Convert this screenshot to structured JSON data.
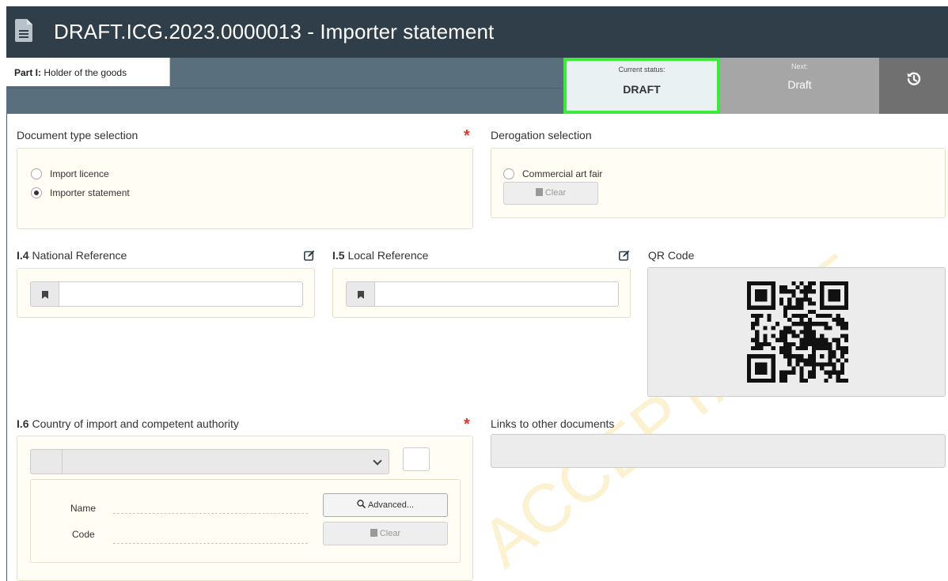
{
  "header": {
    "title": "DRAFT.ICG.2023.0000013 - Importer statement"
  },
  "tabs": {
    "active_prefix": "Part I:",
    "active_label": "Holder of the goods"
  },
  "status": {
    "current_label": "Current status:",
    "current_value": "DRAFT",
    "next_label": "Next:",
    "next_value": "Draft"
  },
  "document_type": {
    "label": "Document type selection",
    "options": [
      {
        "label": "Import licence",
        "checked": false
      },
      {
        "label": "Importer statement",
        "checked": true
      }
    ]
  },
  "derogation": {
    "label": "Derogation selection",
    "option": "Commercial art fair",
    "clear_label": "Clear"
  },
  "national_ref": {
    "prefix": "I.4",
    "label": "National Reference",
    "value": ""
  },
  "local_ref": {
    "prefix": "I.5",
    "label": "Local Reference",
    "value": ""
  },
  "qr": {
    "label": "QR Code"
  },
  "country": {
    "prefix": "I.6",
    "label": "Country of import and competent authority",
    "name_label": "Name",
    "code_label": "Code",
    "advanced_label": "Advanced...",
    "clear_label": "Clear"
  },
  "links": {
    "label": "Links to other documents"
  },
  "watermark": {
    "text": "ACCEPTANCE"
  },
  "colors": {
    "header_bg": "#2f3e48",
    "tabbar_bg": "#5a6f7d",
    "current_status_border": "#3bea3b",
    "required": "#e4342c",
    "panel_bg": "#fffdf4"
  }
}
